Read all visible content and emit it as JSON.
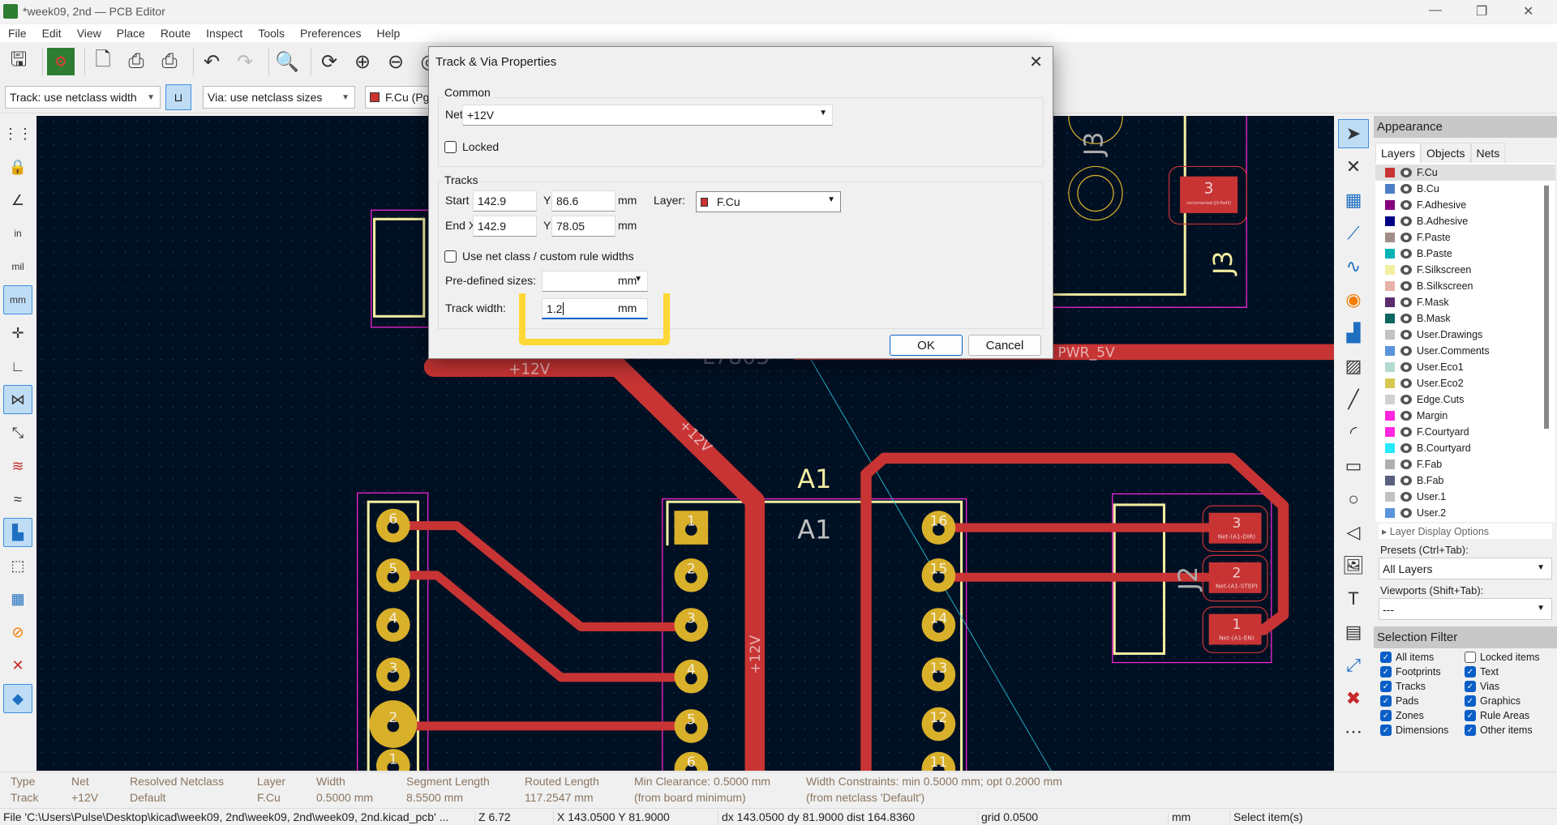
{
  "window": {
    "title": "*week09, 2nd — PCB Editor",
    "minimize": "—",
    "maximize": "❐",
    "close": "✕"
  },
  "menu": [
    "File",
    "Edit",
    "View",
    "Place",
    "Route",
    "Inspect",
    "Tools",
    "Preferences",
    "Help"
  ],
  "toolbar2": {
    "track_width": "Track: use netclass width",
    "via_size": "Via: use netclass sizes",
    "layer": "F.Cu (Pg"
  },
  "colors": {
    "canvas_bg": "#001023",
    "copper": "#c83434",
    "pad": "#d9b02a",
    "silk": "#f2eda1",
    "courtyard": "#ff26e2",
    "accent": "#0a5ec7",
    "highlight": "#fdd835"
  },
  "canvas": {
    "labels": {
      "net_12v_a": "+12V",
      "net_12v_b": "+12V",
      "net_12v_c": "+12V",
      "pwr": "PWR_5V",
      "a1_ref": "A1",
      "a1_val": "A1",
      "j3_a": "J3",
      "j3_b": "J3",
      "j2": "J2",
      "partial": "L7805"
    },
    "pads_left": [
      "6",
      "5",
      "4",
      "3",
      "2",
      "1"
    ],
    "pads_mid": [
      "1",
      "2",
      "3",
      "4",
      "5",
      "6"
    ],
    "pads_right": [
      "16",
      "15",
      "14",
      "13",
      "12",
      "11"
    ],
    "j2_pads": [
      {
        "num": "3",
        "net": "Net-(A1-DIR)"
      },
      {
        "num": "2",
        "net": "Net-(A1-STEP)"
      },
      {
        "num": "1",
        "net": "Net-(A1-EN)"
      }
    ],
    "j3_pad": {
      "num": "3",
      "net": "unconnected-(J3-Pad3)"
    }
  },
  "dialog": {
    "title": "Track & Via Properties",
    "common_label": "Common",
    "net_label": "Net:",
    "net_value": "+12V",
    "locked_label": "Locked",
    "locked": false,
    "tracks_label": "Tracks",
    "start_x_label": "Start X:",
    "start_x": "142.9",
    "start_y_label": "Y:",
    "start_y": "86.6",
    "end_x_label": "End X:",
    "end_x": "142.9",
    "end_y_label": "Y:",
    "end_y": "78.05",
    "unit": "mm",
    "layer_label": "Layer:",
    "layer_value": "F.Cu",
    "use_netclass_label": "Use net class / custom rule widths",
    "use_netclass": false,
    "predefined_label": "Pre-defined sizes:",
    "predefined_value": "",
    "track_width_label": "Track width:",
    "track_width": "1.2",
    "ok": "OK",
    "cancel": "Cancel"
  },
  "appearance": {
    "title": "Appearance",
    "tabs": [
      "Layers",
      "Objects",
      "Nets"
    ],
    "layers": [
      {
        "name": "F.Cu",
        "color": "#c83434"
      },
      {
        "name": "B.Cu",
        "color": "#4d7fc4"
      },
      {
        "name": "F.Adhesive",
        "color": "#84007c"
      },
      {
        "name": "B.Adhesive",
        "color": "#000084"
      },
      {
        "name": "F.Paste",
        "color": "#a08f88"
      },
      {
        "name": "B.Paste",
        "color": "#00b2b2"
      },
      {
        "name": "F.Silkscreen",
        "color": "#f2eda1"
      },
      {
        "name": "B.Silkscreen",
        "color": "#e8b2a7"
      },
      {
        "name": "F.Mask",
        "color": "#5c2a6e"
      },
      {
        "name": "B.Mask",
        "color": "#0d6660"
      },
      {
        "name": "User.Drawings",
        "color": "#c2c2c2"
      },
      {
        "name": "User.Comments",
        "color": "#5994dc"
      },
      {
        "name": "User.Eco1",
        "color": "#b4dbd2"
      },
      {
        "name": "User.Eco2",
        "color": "#d8c852"
      },
      {
        "name": "Edge.Cuts",
        "color": "#d0d0d0"
      },
      {
        "name": "Margin",
        "color": "#ff26e2"
      },
      {
        "name": "F.Courtyard",
        "color": "#ff26e2"
      },
      {
        "name": "B.Courtyard",
        "color": "#26e9ff"
      },
      {
        "name": "F.Fab",
        "color": "#afafaf"
      },
      {
        "name": "B.Fab",
        "color": "#58607e"
      },
      {
        "name": "User.1",
        "color": "#c2c2c2"
      },
      {
        "name": "User.2",
        "color": "#5994dc"
      }
    ],
    "layer_display_options": "Layer Display Options",
    "presets_label": "Presets (Ctrl+Tab):",
    "presets_value": "All Layers",
    "viewports_label": "Viewports (Shift+Tab):",
    "viewports_value": "---"
  },
  "selection_filter": {
    "title": "Selection Filter",
    "items": [
      {
        "label": "All items",
        "checked": true
      },
      {
        "label": "Locked items",
        "checked": false
      },
      {
        "label": "Footprints",
        "checked": true
      },
      {
        "label": "Text",
        "checked": true
      },
      {
        "label": "Tracks",
        "checked": true
      },
      {
        "label": "Vias",
        "checked": true
      },
      {
        "label": "Pads",
        "checked": true
      },
      {
        "label": "Graphics",
        "checked": true
      },
      {
        "label": "Zones",
        "checked": true
      },
      {
        "label": "Rule Areas",
        "checked": true
      },
      {
        "label": "Dimensions",
        "checked": true
      },
      {
        "label": "Other items",
        "checked": true
      }
    ]
  },
  "info": {
    "type": {
      "h": "Type",
      "v": "Track"
    },
    "net": {
      "h": "Net",
      "v": "+12V"
    },
    "netclass": {
      "h": "Resolved Netclass",
      "v": "Default"
    },
    "layer": {
      "h": "Layer",
      "v": "F.Cu"
    },
    "width": {
      "h": "Width",
      "v": "0.5000 mm"
    },
    "seglen": {
      "h": "Segment Length",
      "v": "8.5500 mm"
    },
    "routed": {
      "h": "Routed Length",
      "v": "117.2547 mm"
    },
    "clear": {
      "h": "Min Clearance: 0.5000 mm",
      "v": "(from board minimum)"
    },
    "wc": {
      "h": "Width Constraints: min 0.5000 mm; opt 0.2000 mm",
      "v": "(from netclass 'Default')"
    }
  },
  "status": {
    "file": "File 'C:\\Users\\Pulse\\Desktop\\kicad\\week09, 2nd\\week09, 2nd\\week09, 2nd.kicad_pcb' ...",
    "zoom": "Z 6.72",
    "xy": "X 143.0500  Y 81.9000",
    "delta": "dx 143.0500  dy 81.9000  dist 164.8360",
    "grid": "grid 0.0500",
    "unit": "mm",
    "mode": "Select item(s)"
  }
}
